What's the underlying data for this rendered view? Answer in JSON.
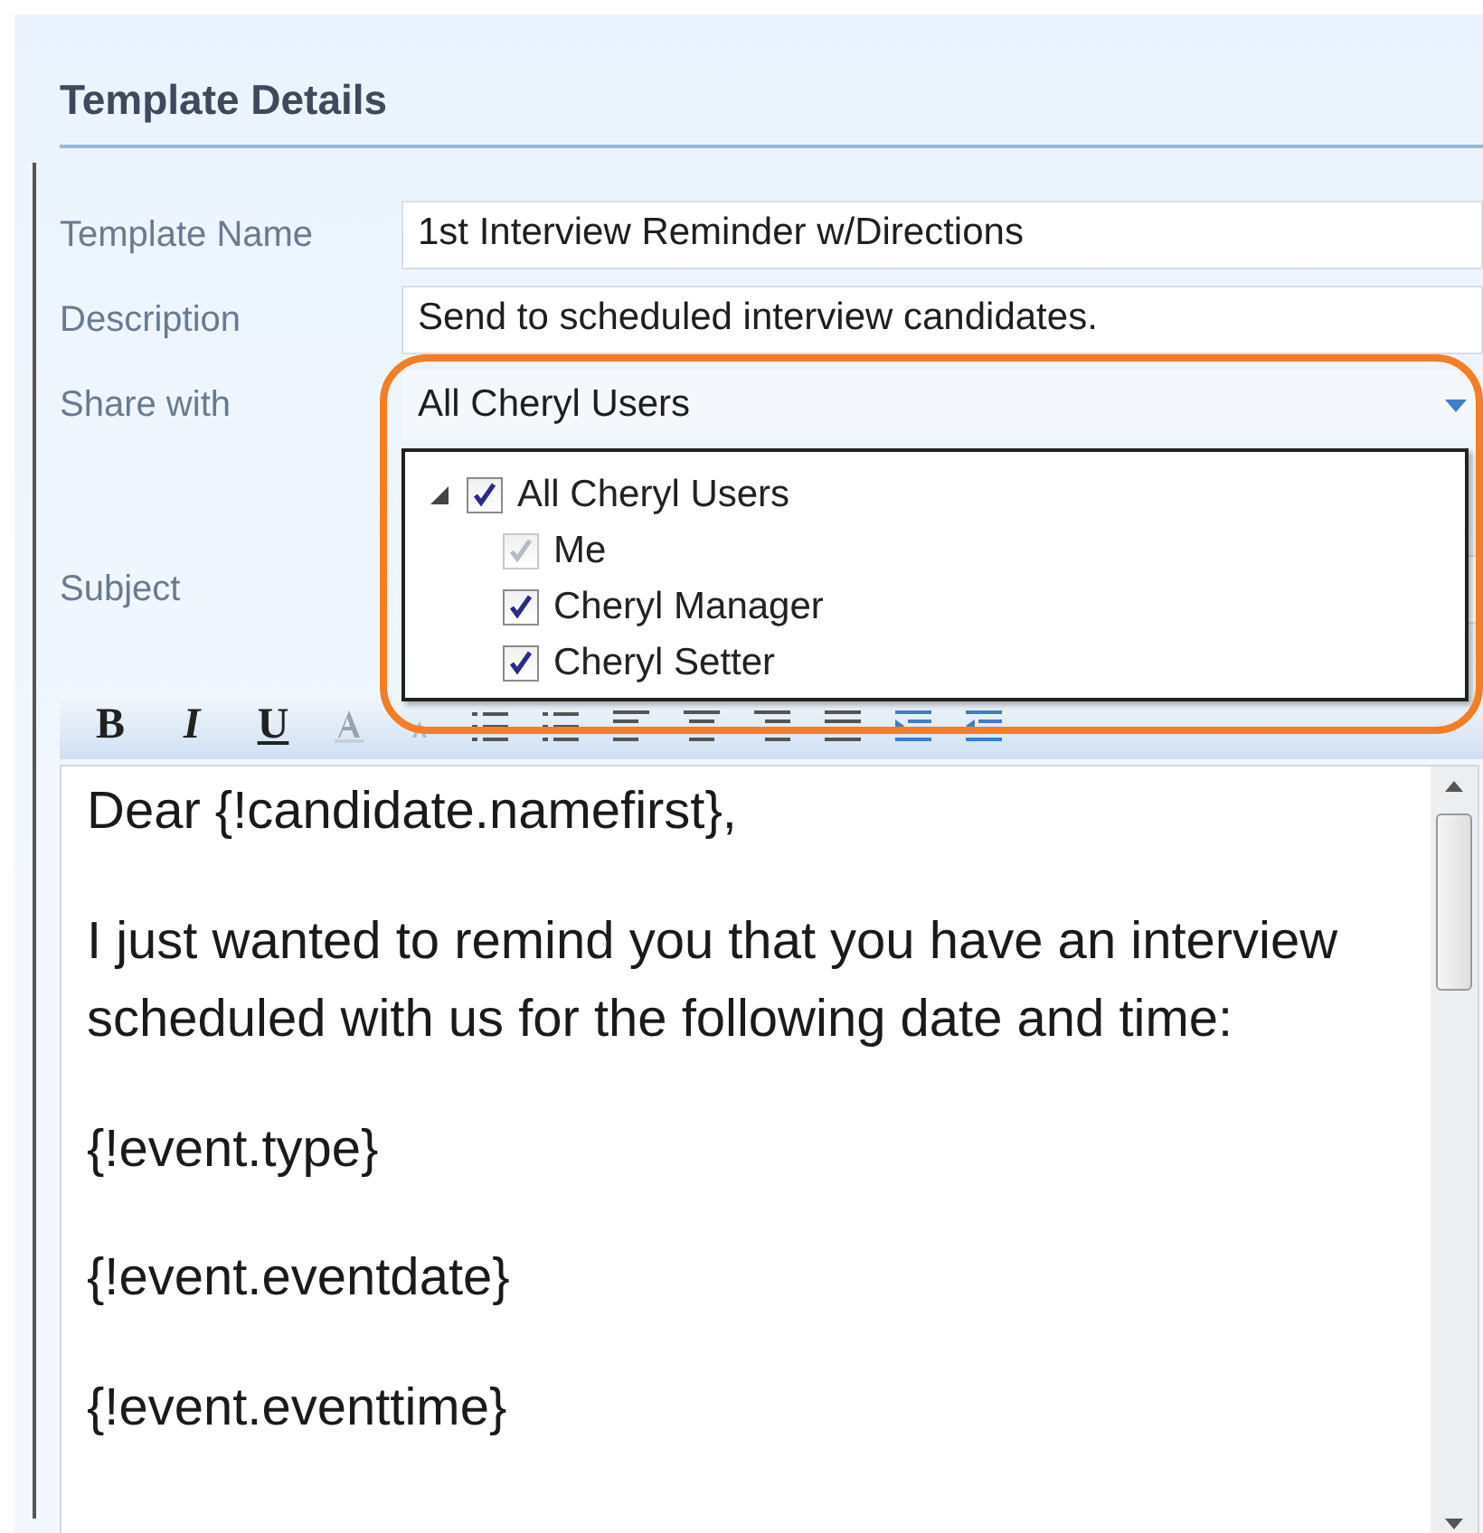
{
  "panel": {
    "title": "Template Details"
  },
  "fields": [
    {
      "label": "Template Name",
      "value": "1st Interview Reminder w/Directions",
      "kind": "text"
    },
    {
      "label": "Description",
      "value": "Send to scheduled interview candidates.",
      "kind": "text"
    },
    {
      "label": "Share with",
      "value": "All Cheryl Users",
      "kind": "dropdown",
      "expanded": true
    }
  ],
  "share_tree": [
    {
      "label": "All Cheryl Users",
      "checked": true,
      "disabled": false,
      "expanded": true,
      "children": [
        {
          "label": "Me",
          "checked": true,
          "disabled": true
        },
        {
          "label": "Cheryl Manager",
          "checked": true,
          "disabled": false
        },
        {
          "label": "Cheryl Setter",
          "checked": true,
          "disabled": false
        }
      ]
    }
  ],
  "subject": {
    "label": "Subject"
  },
  "toolbar": [
    {
      "kind": "bold",
      "label": "B"
    },
    {
      "kind": "italic",
      "label": "I"
    },
    {
      "kind": "underline",
      "label": "U"
    },
    {
      "kind": "font-color"
    },
    {
      "kind": "font-size"
    },
    {
      "kind": "bullets"
    },
    {
      "kind": "numbering"
    },
    {
      "kind": "align-left"
    },
    {
      "kind": "align-center"
    },
    {
      "kind": "align-right"
    },
    {
      "kind": "justify"
    },
    {
      "kind": "indent"
    },
    {
      "kind": "outdent"
    }
  ],
  "editor": {
    "paragraphs": [
      "Dear {!candidate.namefirst},",
      "I just wanted to remind you that you have an interview scheduled with us for the following date and time:",
      "{!event.type}",
      "{!event.eventdate}",
      "{!event.eventtime}"
    ]
  }
}
